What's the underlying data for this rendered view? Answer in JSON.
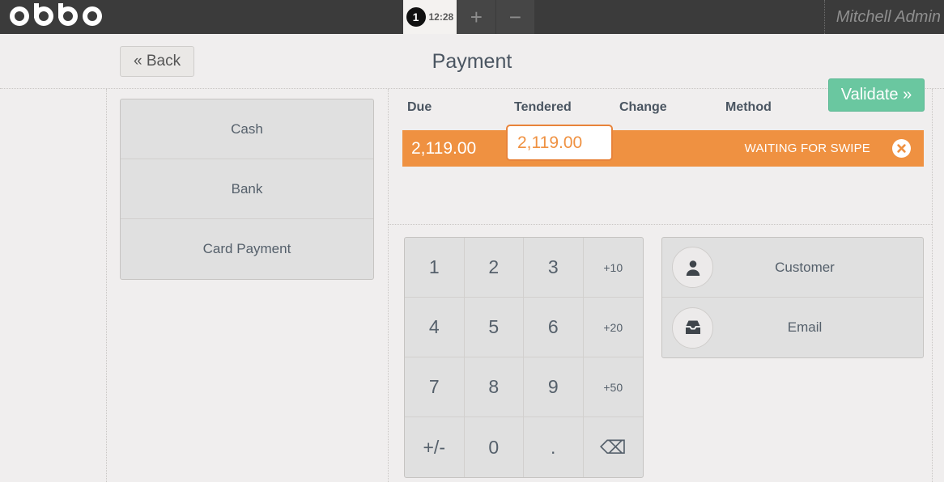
{
  "topbar": {
    "brand": "odoo",
    "order_badge": "1",
    "order_time": "12:28",
    "add_order_label": "+",
    "remove_order_label": "−",
    "username": "Mitchell Admin",
    "background_color": "#3b3b3b"
  },
  "header": {
    "back_label": "« Back",
    "title": "Payment",
    "validate_label": "Validate »",
    "validate_color": "#6ac7a0"
  },
  "payment_methods": {
    "items": [
      {
        "label": "Cash"
      },
      {
        "label": "Bank"
      },
      {
        "label": "Card Payment"
      }
    ]
  },
  "paymentlines": {
    "columns": {
      "due": "Due",
      "tendered": "Tendered",
      "change": "Change",
      "method": "Method"
    },
    "rows": [
      {
        "due": "2,119.00",
        "tendered": "2,119.00",
        "change": "",
        "method_status": "WAITING FOR SWIPE",
        "highlight_color": "#ef9141",
        "selected": true
      }
    ]
  },
  "keypad": {
    "keys": [
      {
        "label": "1",
        "kind": "digit"
      },
      {
        "label": "2",
        "kind": "digit"
      },
      {
        "label": "3",
        "kind": "digit"
      },
      {
        "label": "+10",
        "kind": "preset"
      },
      {
        "label": "4",
        "kind": "digit"
      },
      {
        "label": "5",
        "kind": "digit"
      },
      {
        "label": "6",
        "kind": "digit"
      },
      {
        "label": "+20",
        "kind": "preset"
      },
      {
        "label": "7",
        "kind": "digit"
      },
      {
        "label": "8",
        "kind": "digit"
      },
      {
        "label": "9",
        "kind": "digit"
      },
      {
        "label": "+50",
        "kind": "preset"
      },
      {
        "label": "+/-",
        "kind": "sign"
      },
      {
        "label": "0",
        "kind": "digit"
      },
      {
        "label": ".",
        "kind": "decimal"
      },
      {
        "label": "⌫",
        "kind": "backspace"
      }
    ]
  },
  "customer_panel": {
    "rows": [
      {
        "label": "Customer",
        "icon": "user-icon"
      },
      {
        "label": "Email",
        "icon": "inbox-icon"
      }
    ]
  }
}
